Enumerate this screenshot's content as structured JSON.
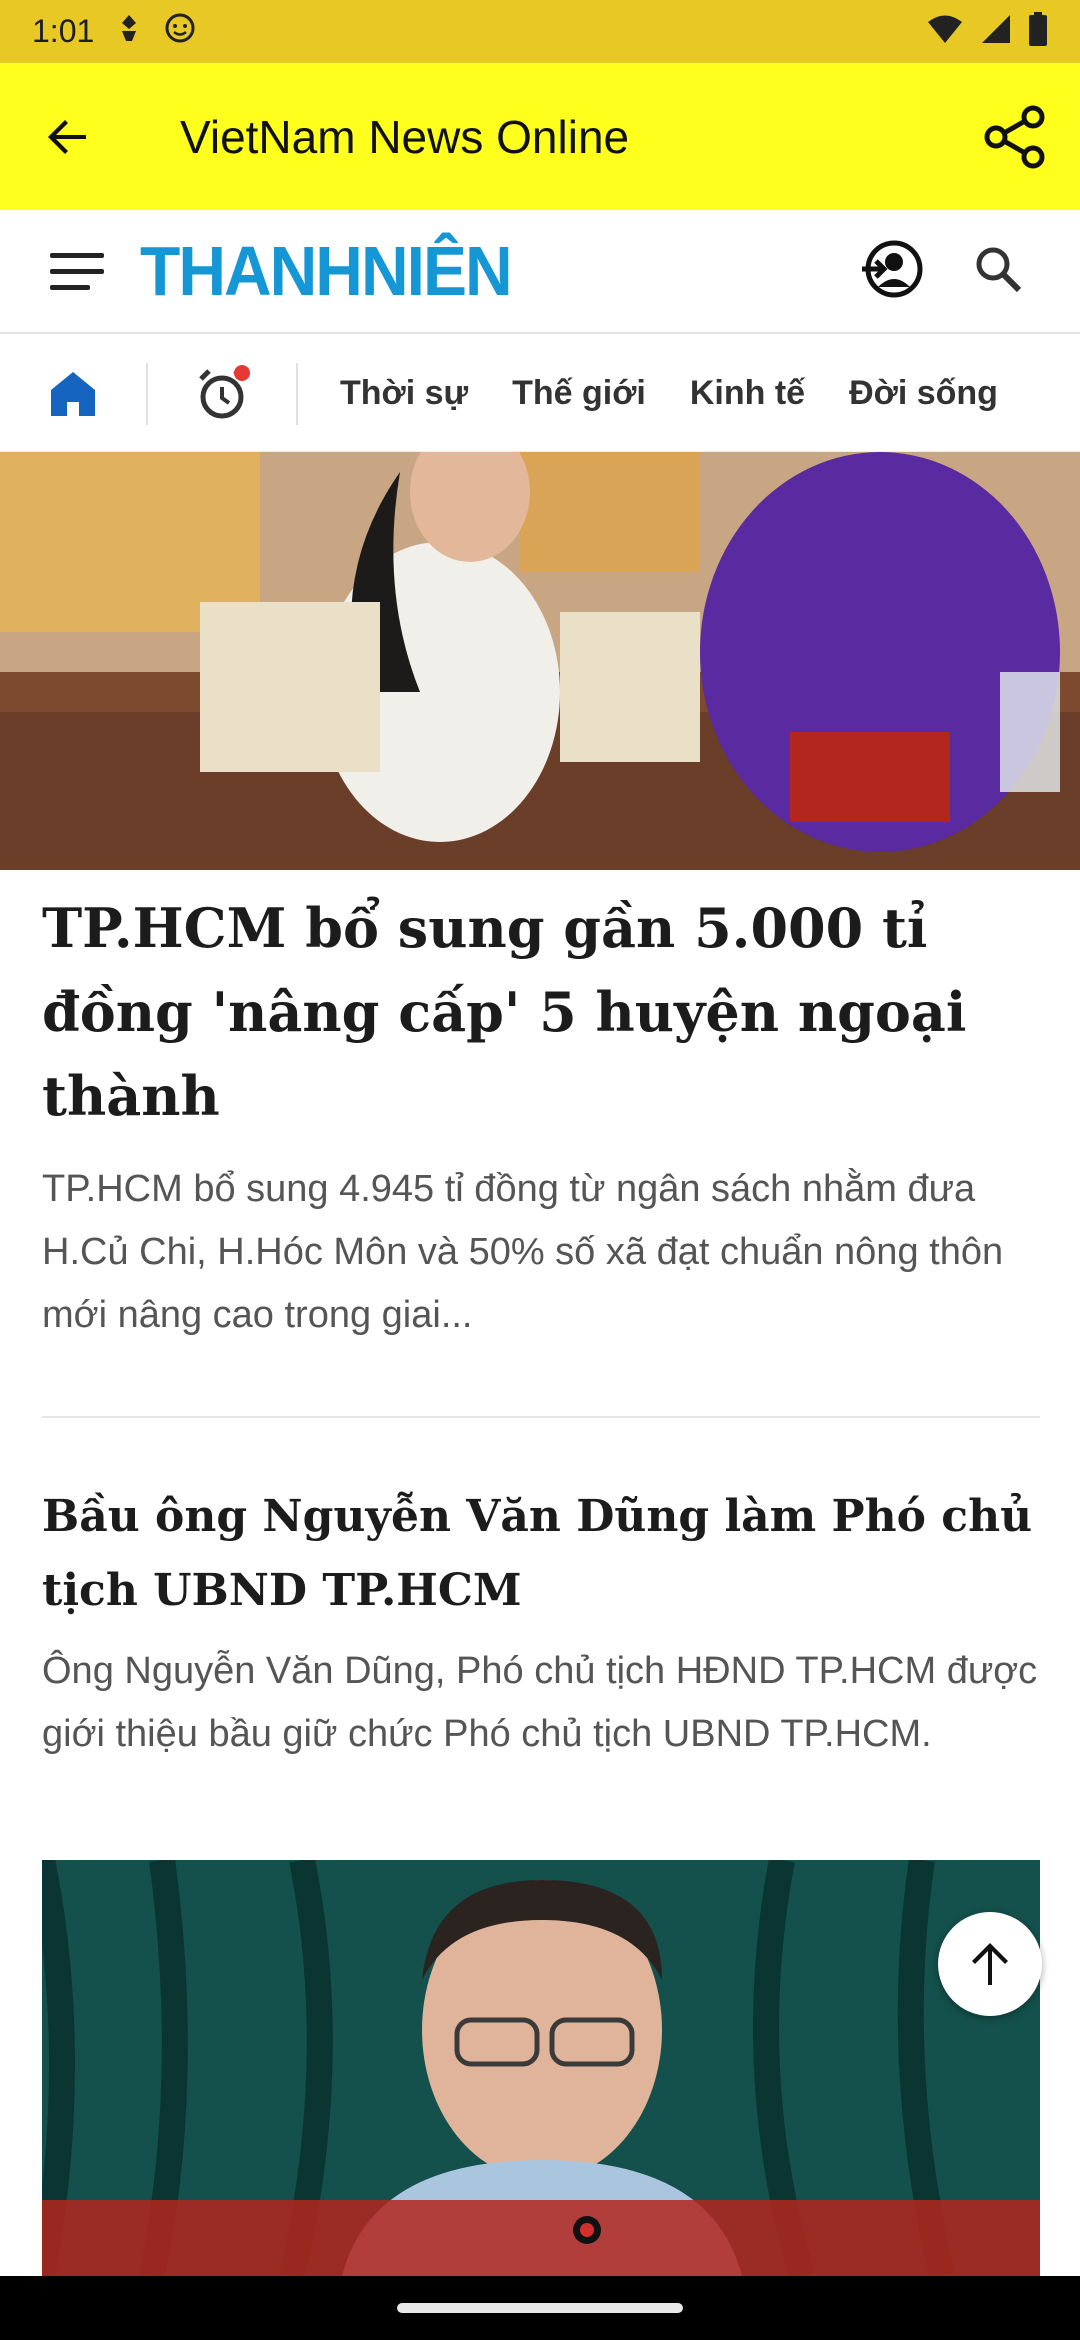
{
  "status_bar": {
    "time": "1:01"
  },
  "app_bar": {
    "title": "VietNam News Online"
  },
  "site": {
    "logo_text": "THANHNIÊN",
    "brand_color": "#1597d6"
  },
  "nav": {
    "tabs": [
      "Thời sự",
      "Thế giới",
      "Kinh tế",
      "Đời sống"
    ],
    "home_color": "#1565c0"
  },
  "articles": [
    {
      "title": "TP.HCM bổ sung gần 5.000 tỉ đồng 'nâng cấp' 5 huyện ngoại thành",
      "summary": "TP.HCM bổ sung 4.945 tỉ đồng từ ngân sách nhằm đưa H.Củ Chi, H.Hóc Môn và 50% số xã đạt chuẩn nông thôn mới nâng cao trong giai..."
    },
    {
      "title": "Bầu ông Nguyễn Văn Dũng làm Phó chủ tịch UBND TP.HCM",
      "summary": "Ông Nguyễn Văn Dũng, Phó chủ tịch HĐND TP.HCM được giới thiệu bầu giữ chức Phó chủ tịch UBND TP.HCM."
    }
  ]
}
